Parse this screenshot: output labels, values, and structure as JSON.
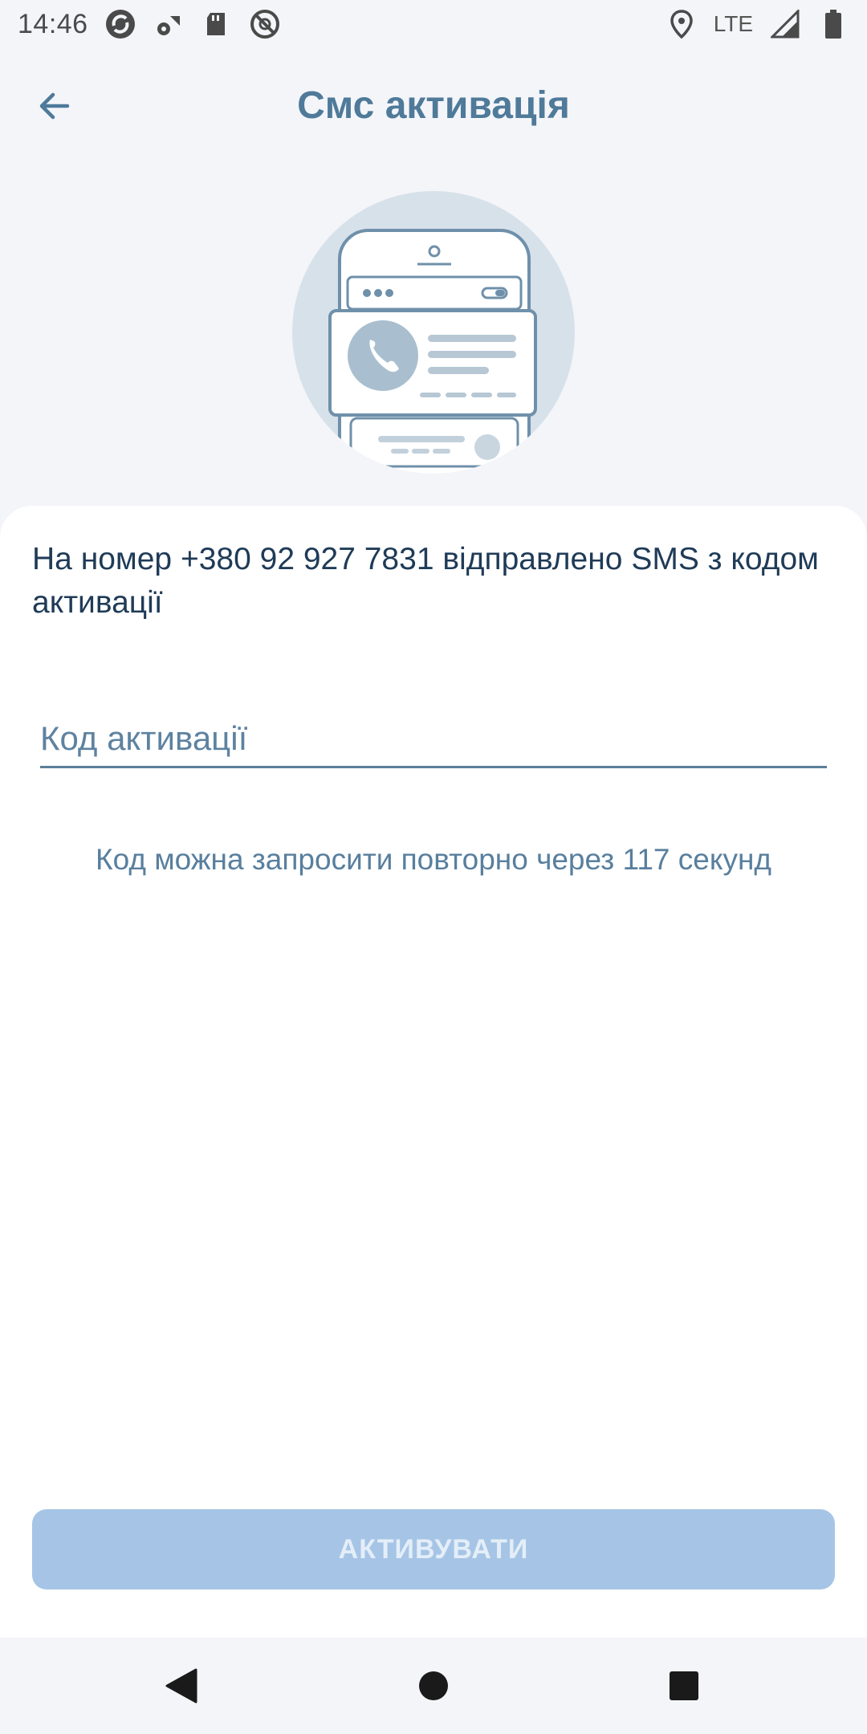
{
  "status_bar": {
    "time": "14:46",
    "network": "LTE",
    "icons": [
      "sync-icon",
      "wifi-settings-icon",
      "sd-card-icon",
      "blocked-icon",
      "location-icon",
      "signal-icon",
      "battery-icon"
    ]
  },
  "header": {
    "title": "Смс активація",
    "back_icon": "arrow-left-icon"
  },
  "illustration": {
    "icon": "phone-sms-illustration"
  },
  "main": {
    "message": "На номер +380 92 927 7831 відправлено SMS з кодом активації",
    "code_input": {
      "value": "",
      "placeholder": "Код активації"
    },
    "resend_text": "Код можна запросити повторно через 117 секунд",
    "activate_label": "АКТИВУВАТИ"
  },
  "colors": {
    "title": "#4f7a99",
    "text_dark": "#1f3b57",
    "button_disabled": "#a6c5e6",
    "background": "#f4f5f9"
  },
  "nav_bar": {
    "items": [
      "back-triangle-icon",
      "home-circle-icon",
      "recents-square-icon"
    ]
  }
}
